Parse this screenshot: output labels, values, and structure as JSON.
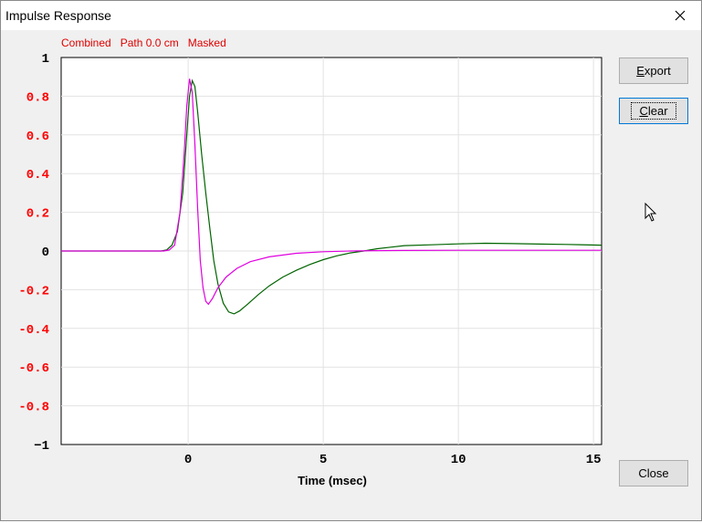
{
  "window": {
    "title": "Impulse Response"
  },
  "status": {
    "combined": "Combined",
    "path": "Path 0.0 cm",
    "masked": "Masked"
  },
  "buttons": {
    "export": {
      "underline": "E",
      "rest": "xport"
    },
    "clear": {
      "underline": "C",
      "rest": "lear"
    },
    "close": "Close"
  },
  "colors": {
    "pos_tick": "#000000",
    "nonzero_tick": "#ff0000",
    "series_green": "#006400",
    "series_magenta": "#e000e0",
    "grid": "#e2e2e2"
  },
  "chart_data": {
    "type": "line",
    "title": "",
    "xlabel": "Time (msec)",
    "ylabel": "",
    "xlim": [
      -4.7,
      15.3
    ],
    "ylim": [
      -1,
      1
    ],
    "x_ticks": [
      0,
      5,
      10,
      15
    ],
    "y_ticks": [
      1,
      0.8,
      0.6,
      0.4,
      0.2,
      0,
      -0.2,
      -0.4,
      -0.6,
      -0.8,
      -1
    ],
    "y_tick_labels": [
      "1",
      "0.8",
      "0.6",
      "0.4",
      "0.2",
      "0",
      "-0.2",
      "-0.4",
      "-0.6",
      "-0.8",
      "−1"
    ],
    "grid": true,
    "series": [
      {
        "color": "green",
        "points": [
          [
            -4.7,
            0
          ],
          [
            -1.0,
            0
          ],
          [
            -0.8,
            0.005
          ],
          [
            -0.6,
            0.03
          ],
          [
            -0.4,
            0.1
          ],
          [
            -0.2,
            0.3
          ],
          [
            -0.05,
            0.6
          ],
          [
            0.05,
            0.8
          ],
          [
            0.15,
            0.88
          ],
          [
            0.25,
            0.85
          ],
          [
            0.35,
            0.72
          ],
          [
            0.5,
            0.5
          ],
          [
            0.65,
            0.3
          ],
          [
            0.8,
            0.12
          ],
          [
            0.95,
            -0.05
          ],
          [
            1.1,
            -0.17
          ],
          [
            1.3,
            -0.27
          ],
          [
            1.5,
            -0.315
          ],
          [
            1.7,
            -0.325
          ],
          [
            1.9,
            -0.31
          ],
          [
            2.2,
            -0.275
          ],
          [
            2.6,
            -0.225
          ],
          [
            3.0,
            -0.18
          ],
          [
            3.5,
            -0.135
          ],
          [
            4.0,
            -0.1
          ],
          [
            4.5,
            -0.07
          ],
          [
            5.0,
            -0.045
          ],
          [
            5.5,
            -0.025
          ],
          [
            6.0,
            -0.01
          ],
          [
            6.5,
            0.0
          ],
          [
            7.0,
            0.012
          ],
          [
            7.5,
            0.02
          ],
          [
            8.0,
            0.028
          ],
          [
            9.0,
            0.032
          ],
          [
            10.0,
            0.037
          ],
          [
            11.0,
            0.04
          ],
          [
            12.0,
            0.038
          ],
          [
            13.0,
            0.036
          ],
          [
            14.0,
            0.034
          ],
          [
            15.3,
            0.03
          ]
        ]
      },
      {
        "color": "magenta",
        "points": [
          [
            -4.7,
            0
          ],
          [
            -0.9,
            0
          ],
          [
            -0.7,
            0.005
          ],
          [
            -0.5,
            0.03
          ],
          [
            -0.3,
            0.2
          ],
          [
            -0.15,
            0.5
          ],
          [
            -0.05,
            0.75
          ],
          [
            0.05,
            0.89
          ],
          [
            0.15,
            0.82
          ],
          [
            0.25,
            0.55
          ],
          [
            0.35,
            0.22
          ],
          [
            0.45,
            -0.05
          ],
          [
            0.55,
            -0.19
          ],
          [
            0.65,
            -0.26
          ],
          [
            0.75,
            -0.275
          ],
          [
            0.9,
            -0.245
          ],
          [
            1.1,
            -0.19
          ],
          [
            1.4,
            -0.135
          ],
          [
            1.8,
            -0.09
          ],
          [
            2.3,
            -0.055
          ],
          [
            3.0,
            -0.03
          ],
          [
            4.0,
            -0.012
          ],
          [
            5.0,
            -0.004
          ],
          [
            6.0,
            0.0
          ],
          [
            7.0,
            0.002
          ],
          [
            8.0,
            0.003
          ],
          [
            10.0,
            0.004
          ],
          [
            12.0,
            0.004
          ],
          [
            15.3,
            0.004
          ]
        ]
      }
    ]
  }
}
